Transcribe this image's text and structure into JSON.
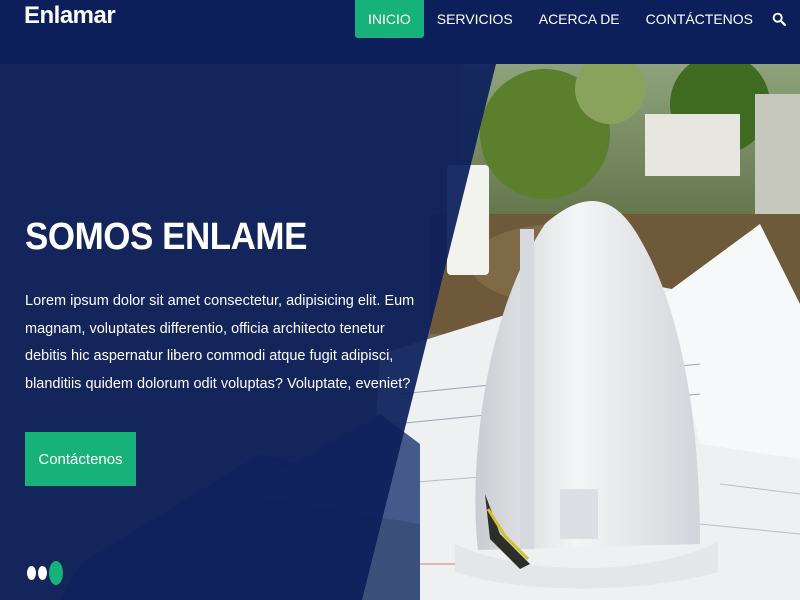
{
  "brand": {
    "name": "Enlamar"
  },
  "nav": {
    "items": [
      {
        "label": "INICIO",
        "active": true
      },
      {
        "label": "SERVICIOS",
        "active": false
      },
      {
        "label": "ACERCA DE",
        "active": false
      },
      {
        "label": "CONTÁCTENOS",
        "active": false
      }
    ],
    "search_icon": "search-icon"
  },
  "hero": {
    "title": "SOMOS ENLAME",
    "text": "Lorem ipsum dolor sit amet consectetur, adipisicing elit. Eum magnam, voluptates differentio, officia architecto tenetur debitis hic aspernatur libero commodi atque fugit adipisci, blanditiis quidem dolorum odit voluptas? Voluptate, eveniet?",
    "cta_label": "Contáctenos",
    "slides": {
      "count": 3,
      "active_index": 2
    }
  },
  "colors": {
    "navy": "#0c1f5b",
    "accent": "#17b27a",
    "text": "#ffffff"
  }
}
